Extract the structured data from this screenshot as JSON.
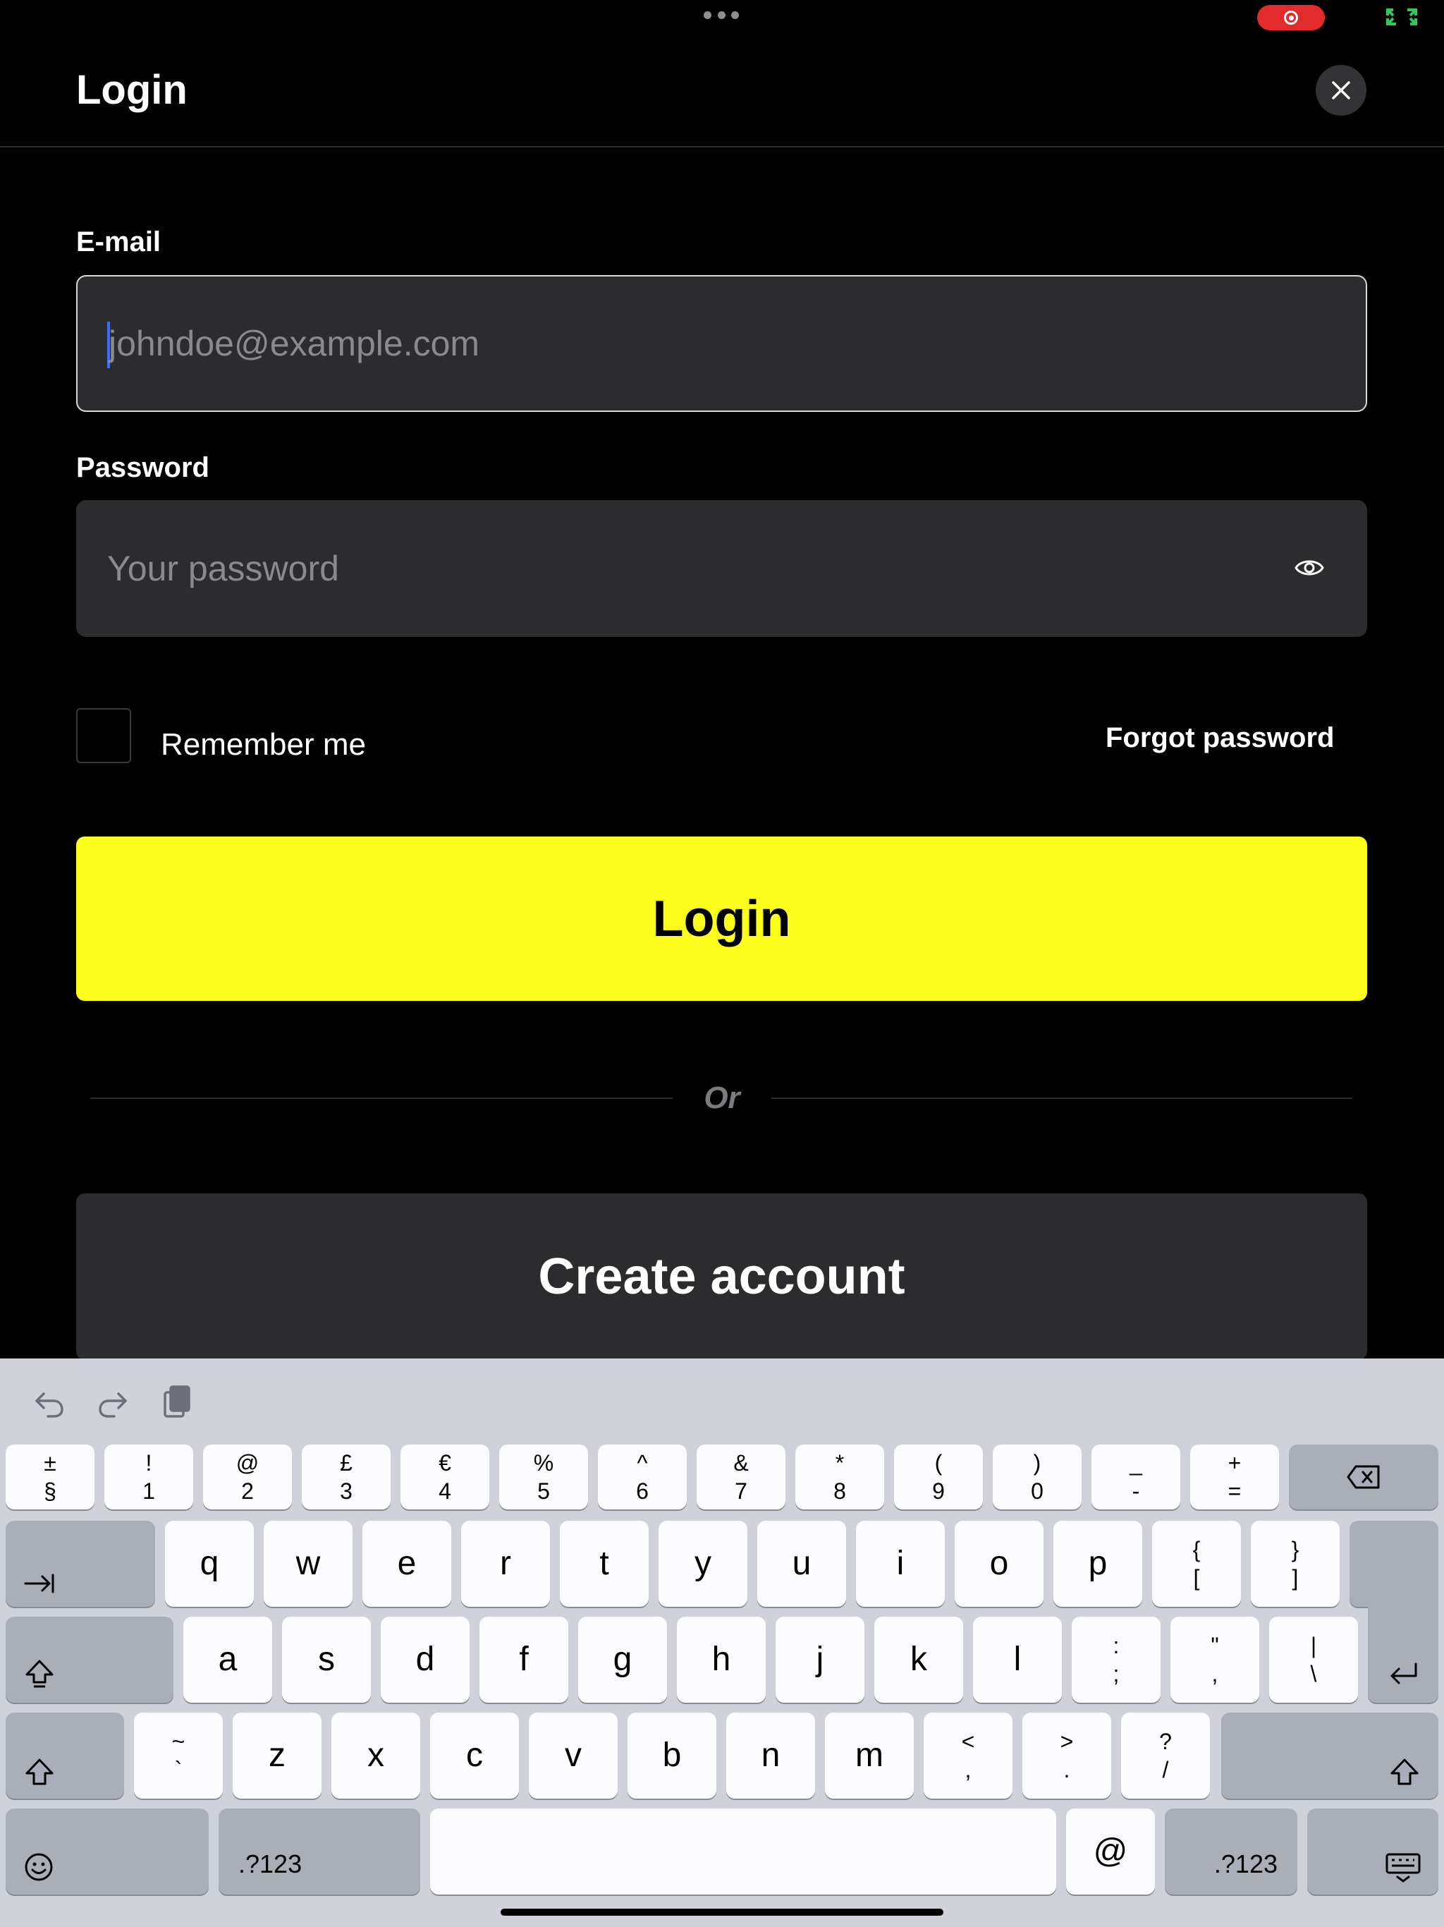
{
  "status": {
    "more_icon": "ellipsis-icon",
    "record_icon": "screen-record-icon",
    "fullscreen_icon": "fullscreen-icon"
  },
  "header": {
    "title": "Login",
    "close_icon": "close-icon"
  },
  "form": {
    "email_label": "E-mail",
    "email_placeholder": "johndoe@example.com",
    "password_label": "Password",
    "password_placeholder": "Your password",
    "eye_icon": "eye-icon",
    "remember_label": "Remember me",
    "remember_checked": false,
    "forgot_label": "Forgot password"
  },
  "buttons": {
    "login": "Login",
    "divider": "Or",
    "create": "Create account"
  },
  "colors": {
    "background": "#000000",
    "field": "#2c2c2e",
    "accent": "#fbfd1c",
    "record": "#e32b2b"
  },
  "keyboard": {
    "toolbar": [
      "undo-icon",
      "redo-icon",
      "clipboard-icon"
    ],
    "row1": [
      {
        "top": "±",
        "bottom": "§"
      },
      {
        "top": "!",
        "bottom": "1"
      },
      {
        "top": "@",
        "bottom": "2"
      },
      {
        "top": "£",
        "bottom": "3"
      },
      {
        "top": "€",
        "bottom": "4"
      },
      {
        "top": "%",
        "bottom": "5"
      },
      {
        "top": "^",
        "bottom": "6"
      },
      {
        "top": "&",
        "bottom": "7"
      },
      {
        "top": "*",
        "bottom": "8"
      },
      {
        "top": "(",
        "bottom": "9"
      },
      {
        "top": ")",
        "bottom": "0"
      },
      {
        "top": "_",
        "bottom": "-"
      },
      {
        "top": "+",
        "bottom": "="
      }
    ],
    "row2": [
      "q",
      "w",
      "e",
      "r",
      "t",
      "y",
      "u",
      "i",
      "o",
      "p",
      {
        "top": "{",
        "bottom": "["
      },
      {
        "top": "}",
        "bottom": "]"
      }
    ],
    "row3": [
      "a",
      "s",
      "d",
      "f",
      "g",
      "h",
      "j",
      "k",
      "l",
      {
        "top": ":",
        "bottom": ";"
      },
      {
        "top": "\"",
        "bottom": ","
      },
      {
        "top": "|",
        "bottom": "\\"
      }
    ],
    "row4": [
      {
        "top": "~",
        "bottom": "`"
      },
      "z",
      "x",
      "c",
      "v",
      "b",
      "n",
      "m",
      {
        "top": "<",
        "bottom": ","
      },
      {
        "top": ">",
        "bottom": "."
      },
      {
        "top": "?",
        "bottom": "/"
      }
    ],
    "numbers_label": ".?123",
    "at_label": "@",
    "icons": {
      "delete": "delete-icon",
      "tab": "tab-icon",
      "caps": "caps-lock-icon",
      "return": "return-icon",
      "shift": "shift-icon",
      "emoji": "emoji-icon",
      "dismiss": "keyboard-dismiss-icon"
    }
  }
}
